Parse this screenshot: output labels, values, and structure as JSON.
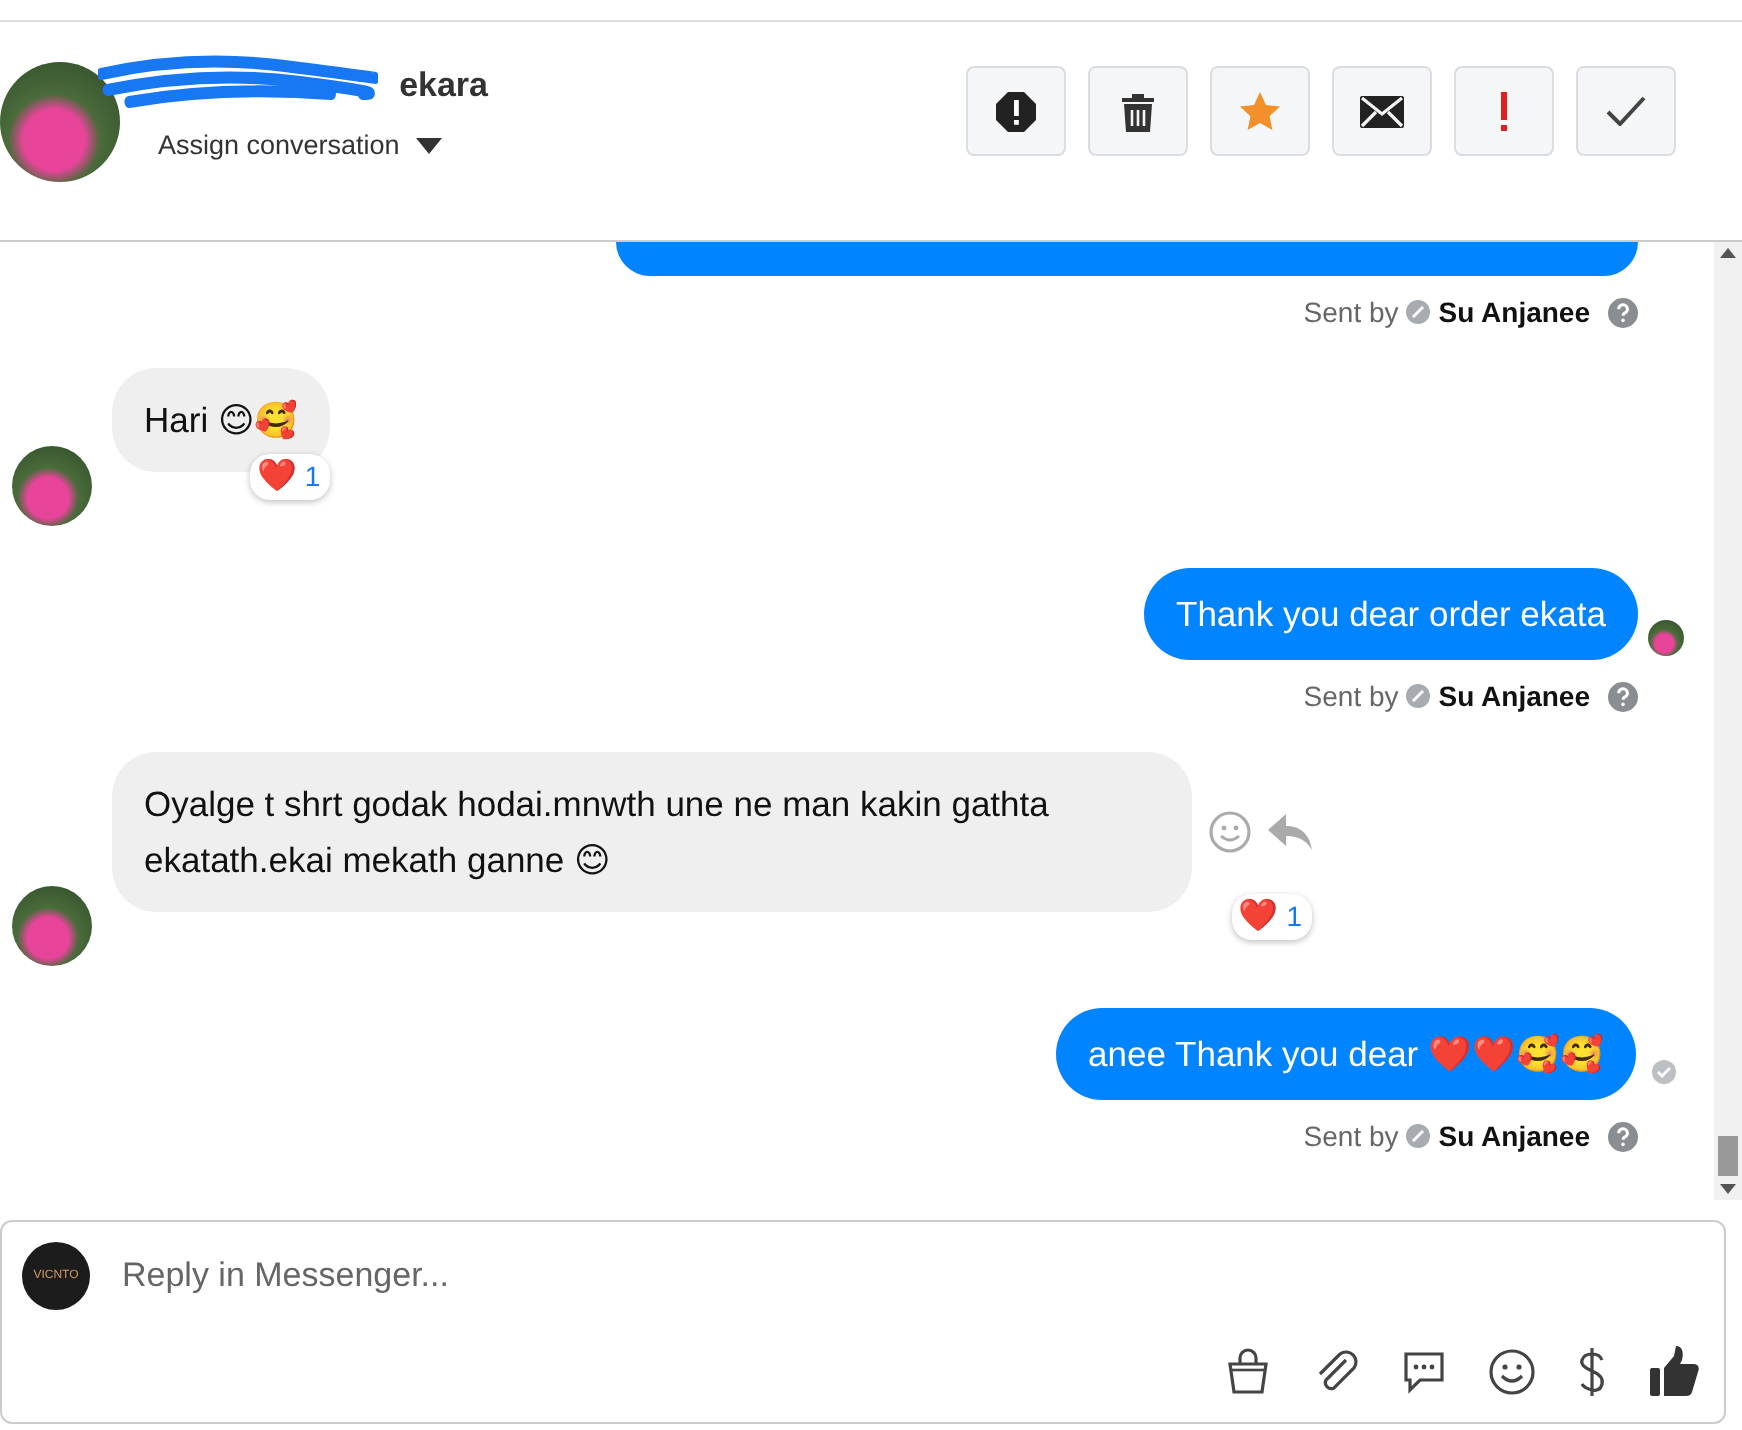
{
  "header": {
    "name": "ekara",
    "assign": "Assign conversation"
  },
  "actions": [
    {
      "kind": "alert"
    },
    {
      "kind": "trash"
    },
    {
      "kind": "star"
    },
    {
      "kind": "mail"
    },
    {
      "kind": "important"
    },
    {
      "kind": "check"
    }
  ],
  "messages": [
    {
      "kind": "outgoing_cut",
      "sent_by": "Sent by",
      "sender": "Su Anjanee"
    },
    {
      "kind": "incoming",
      "text": "Hari 😊🥰",
      "reaction": "❤️",
      "reaction_count": "1"
    },
    {
      "kind": "outgoing",
      "text": "Thank you dear order ekata",
      "seen": true,
      "sent_by": "Sent by",
      "sender": "Su Anjanee"
    },
    {
      "kind": "incoming",
      "text": "Oyalge t shrt godak hodai.mnwth une ne man kakin gathta ekatath.ekai mekath ganne 😊",
      "reaction": "❤️",
      "reaction_count": "1",
      "hover_actions": true
    },
    {
      "kind": "outgoing",
      "text": "anee Thank you dear ❤️❤️🥰🥰",
      "seen": false,
      "sent_by": "Sent by",
      "sender": "Su Anjanee"
    }
  ],
  "composer": {
    "placeholder": "Reply in Messenger...",
    "logo": "VICNTO"
  }
}
